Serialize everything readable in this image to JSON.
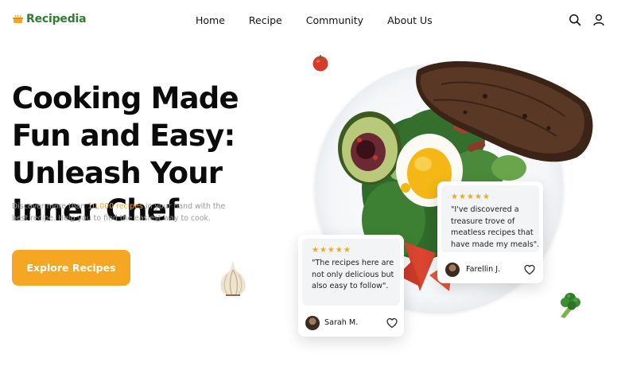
{
  "brand": {
    "name": "Recipedia",
    "logo_icon": "pot-icon",
    "color": "#2f7d32"
  },
  "nav": {
    "items": [
      "Home",
      "Recipe",
      "Community",
      "About Us"
    ],
    "icons": [
      "search-icon",
      "user-icon"
    ]
  },
  "hero": {
    "title": "Cooking Made Fun and Easy: Unleash Your Inner Chef",
    "subtitle_before": "Discover more than ",
    "subtitle_highlight": "10,000 recipes",
    "subtitle_after": " in your hand with the best recipe. Help you to find the easiest way to cook.",
    "cta_label": "Explore Recipes",
    "accent_color": "#f5a623"
  },
  "reviews": [
    {
      "stars": "★★★★★",
      "rating": 5,
      "quote": "\"The recipes here are not only delicious but also easy to follow\".",
      "author": "Sarah M."
    },
    {
      "stars": "★★★★★",
      "rating": 5,
      "quote": "\"I've discovered a treasure trove of meatless recipes that have made my meals\".",
      "author": "Farellin J."
    }
  ],
  "decorations": [
    "tomato-icon",
    "garlic-icon",
    "broccoli-icon",
    "dish-image"
  ]
}
